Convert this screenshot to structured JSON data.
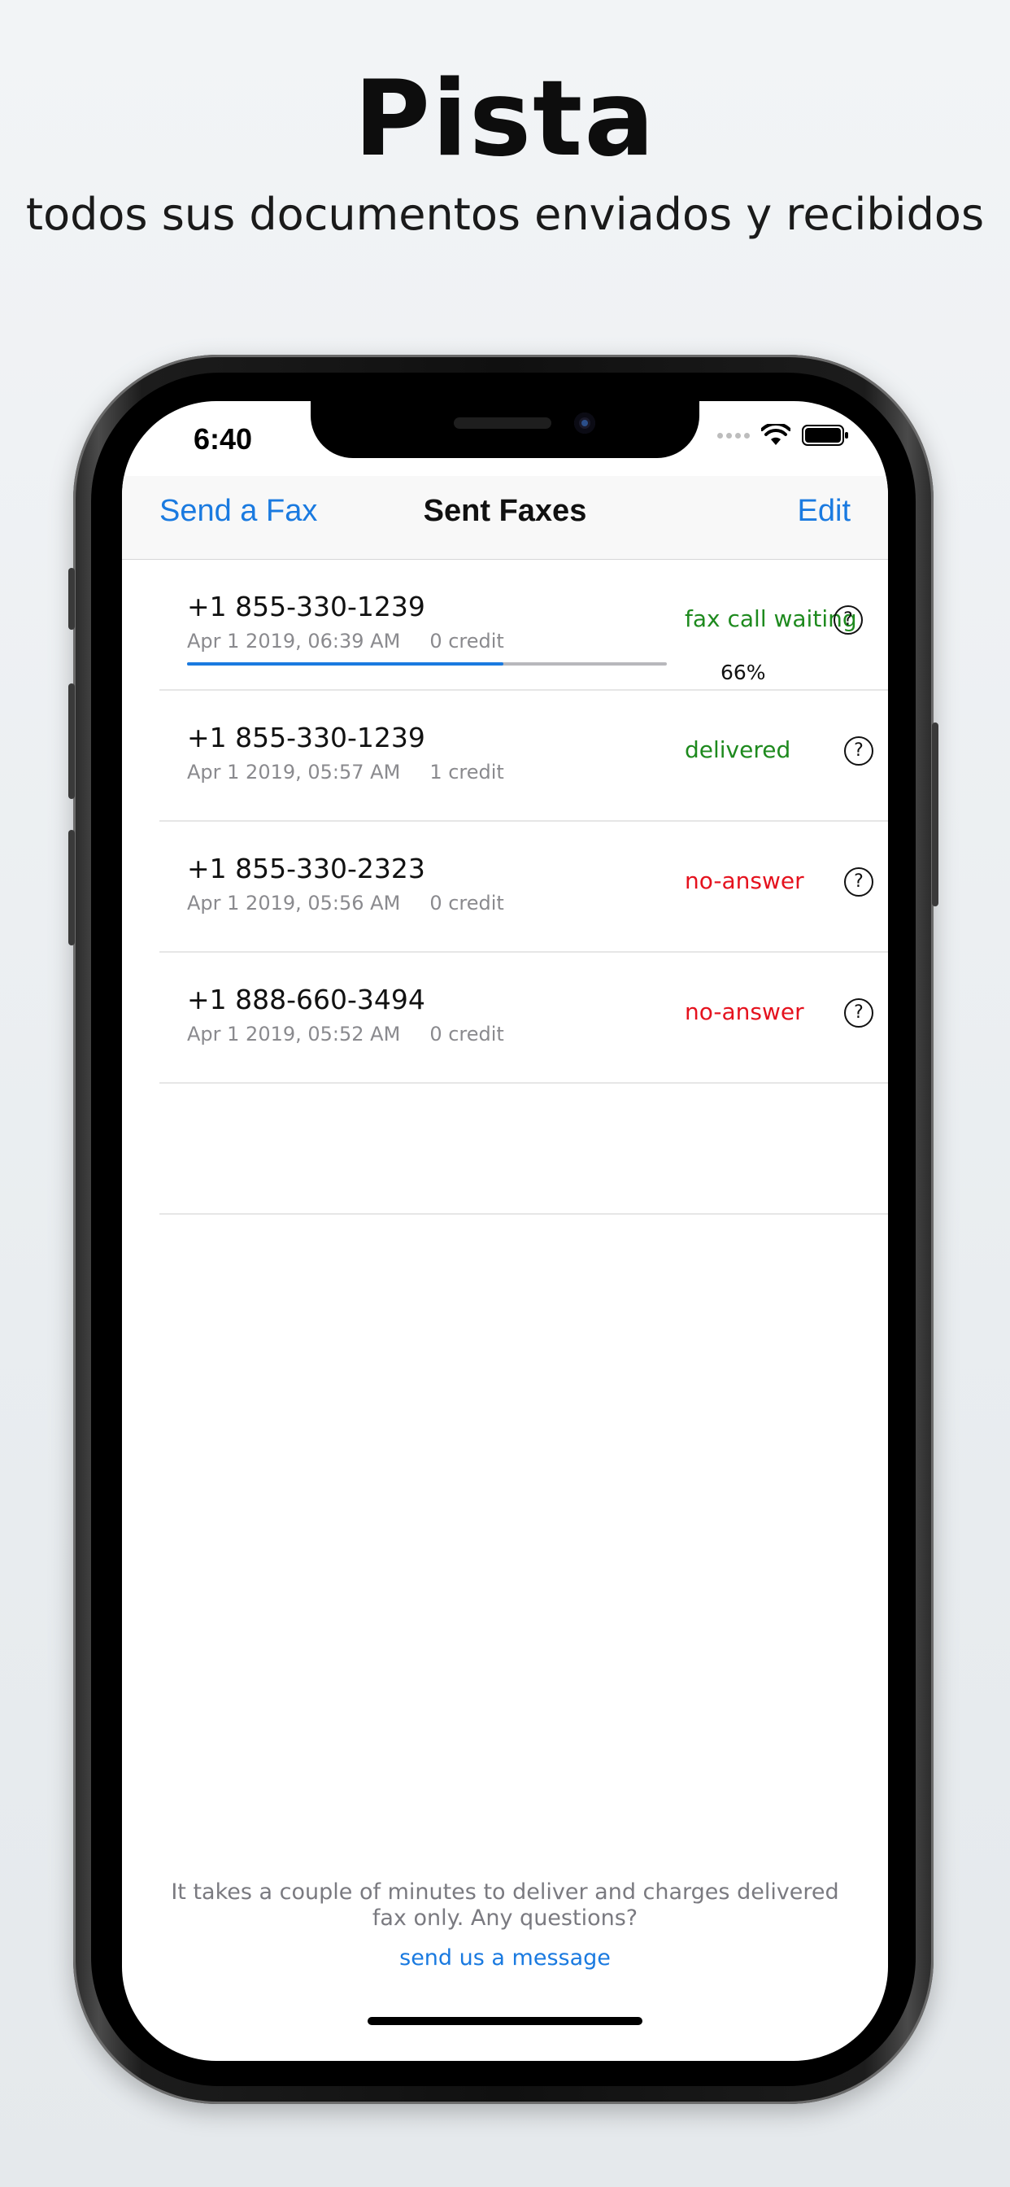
{
  "promo": {
    "headline": "Pista",
    "subheadline": "todos sus documentos enviados y recibidos"
  },
  "status_bar": {
    "time": "6:40"
  },
  "navbar": {
    "left_label": "Send a Fax",
    "title": "Sent Faxes",
    "right_label": "Edit"
  },
  "colors": {
    "accent": "#1a7ae0",
    "status_green": "#1e8a1e",
    "status_red": "#e5121e"
  },
  "faxes": [
    {
      "number": "+1 855-330-1239",
      "date": "Apr 1 2019, 06:39 AM",
      "credit": "0 credit",
      "status": "fax call waiting",
      "status_color": "green",
      "progress_label": "66%",
      "progress": 0.66
    },
    {
      "number": "+1 855-330-1239",
      "date": "Apr 1 2019, 05:57 AM",
      "credit": "1 credit",
      "status": "delivered",
      "status_color": "green"
    },
    {
      "number": "+1 855-330-2323",
      "date": "Apr 1 2019, 05:56 AM",
      "credit": "0 credit",
      "status": "no-answer",
      "status_color": "red"
    },
    {
      "number": "+1 888-660-3494",
      "date": "Apr 1 2019, 05:52 AM",
      "credit": "0 credit",
      "status": "no-answer",
      "status_color": "red"
    }
  ],
  "help_glyph": "?",
  "footer": {
    "note": "It takes a couple of minutes to deliver and charges delivered fax only. Any questions?",
    "link": "send us a message"
  },
  "icons": [
    "signal-icon",
    "wifi-icon",
    "battery-icon",
    "help-icon"
  ]
}
